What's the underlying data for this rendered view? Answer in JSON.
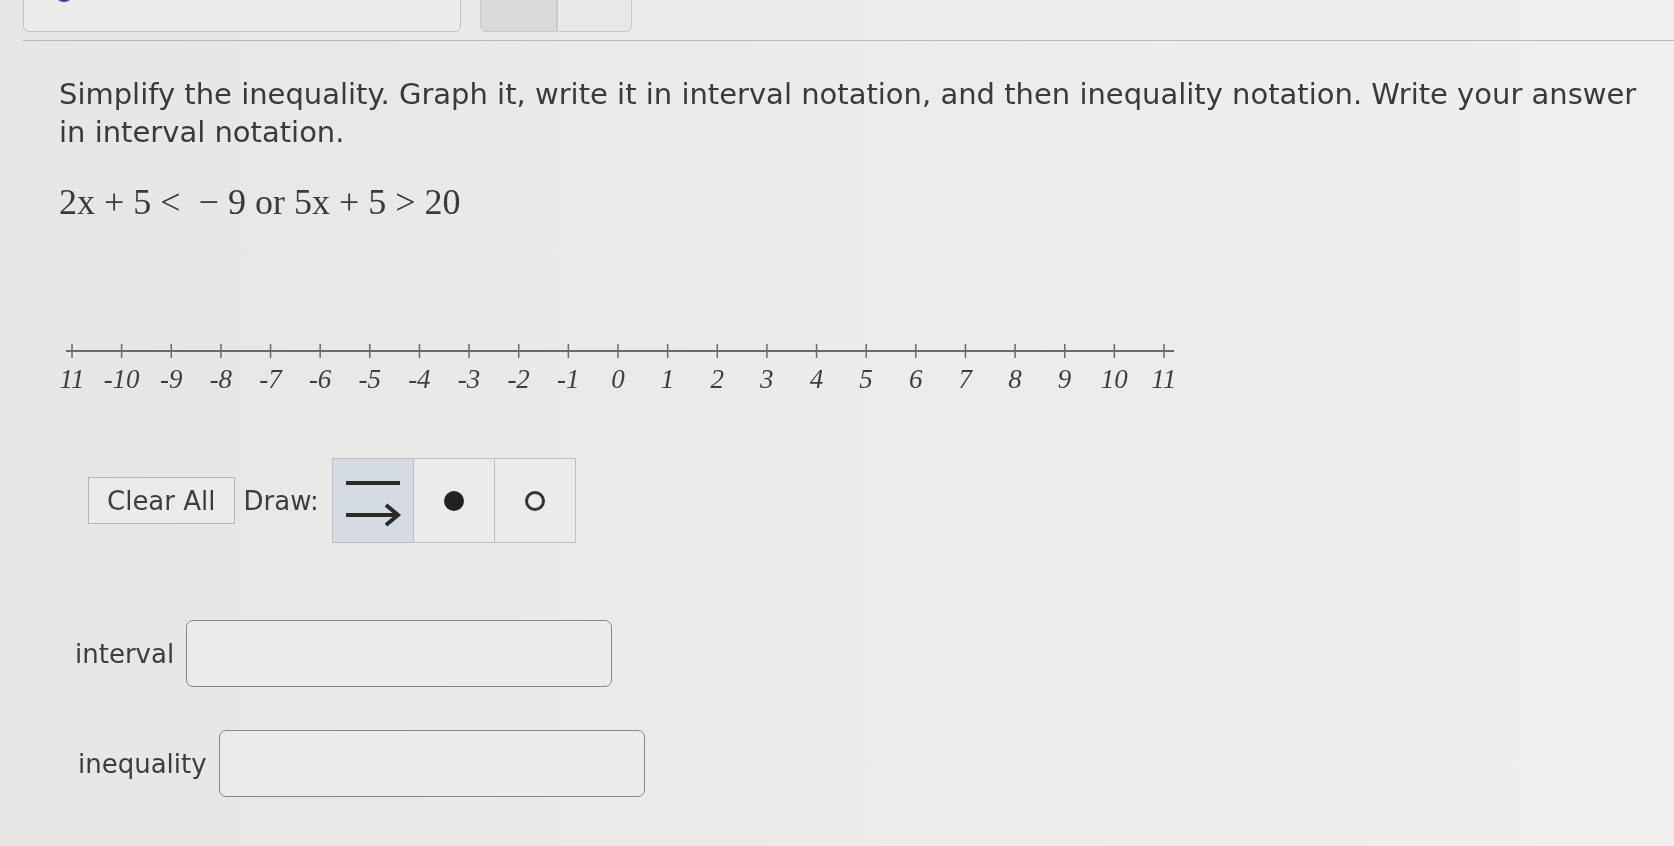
{
  "prompt": "Simplify the inequality. Graph it, write it in interval notation, and then inequality notation. Write your answer in interval notation.",
  "expression": "2x + 5 <  − 9 or 5x + 5 > 20",
  "number_line": {
    "labels": [
      "11",
      "-10",
      "-9",
      "-8",
      "-7",
      "-6",
      "-5",
      "-4",
      "-3",
      "-2",
      "-1",
      "0",
      "1",
      "2",
      "3",
      "4",
      "5",
      "6",
      "7",
      "8",
      "9",
      "10",
      "11"
    ]
  },
  "graph_tools": {
    "clear_button": "Clear All",
    "draw_label": "Draw:",
    "tools": [
      {
        "kind": "ray",
        "selected": true
      },
      {
        "kind": "closed-point",
        "selected": false
      },
      {
        "kind": "open-point",
        "selected": false
      }
    ]
  },
  "answers": [
    {
      "label": "interval"
    },
    {
      "label": "inequality"
    }
  ]
}
